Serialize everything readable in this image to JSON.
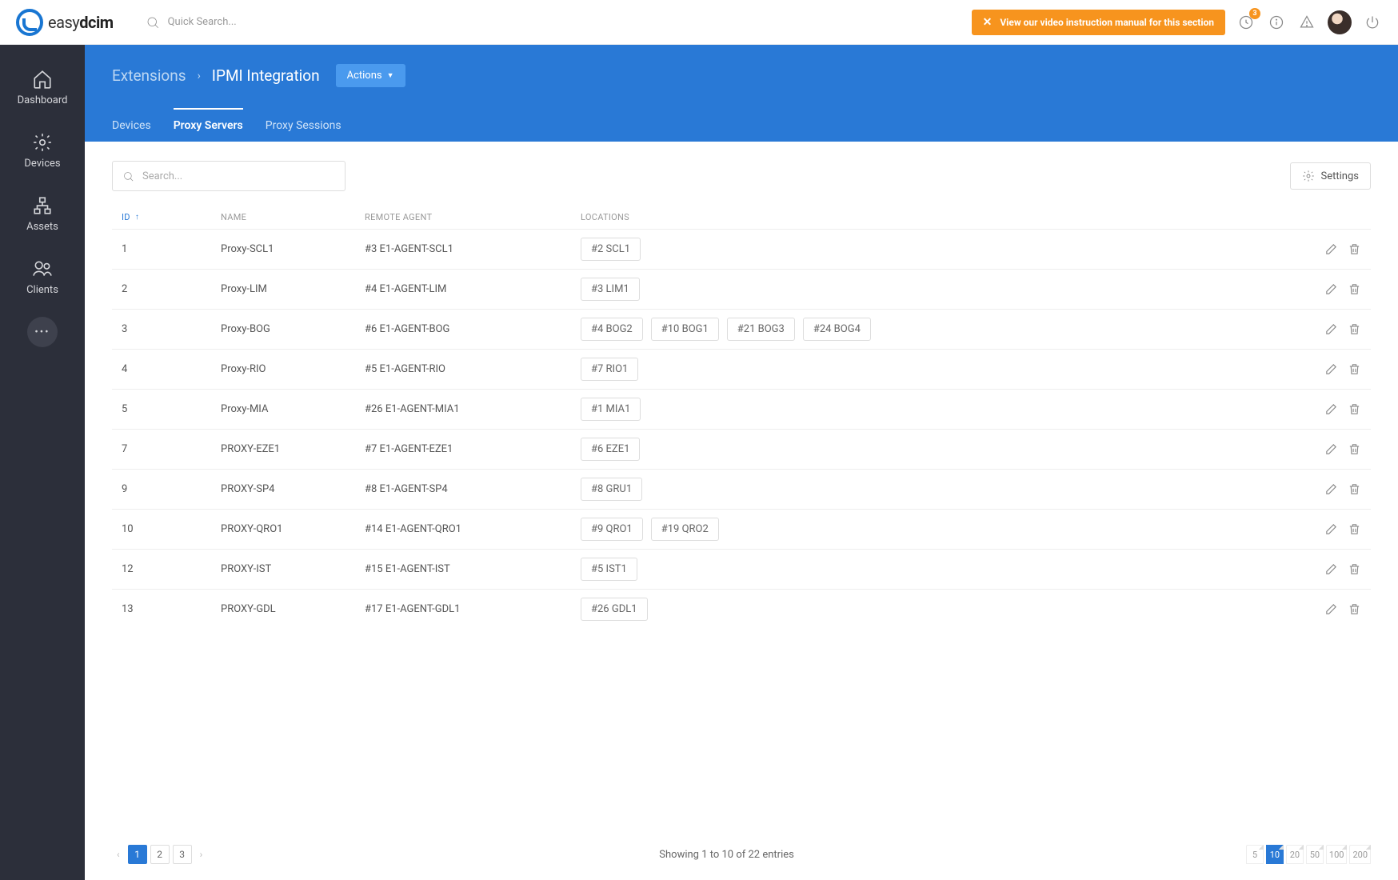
{
  "brand": {
    "easy": "easy",
    "dcim": "dcim"
  },
  "topbar": {
    "search_placeholder": "Quick Search...",
    "banner": "View our video instruction manual for this section",
    "badge_count": "3"
  },
  "sidebar": {
    "items": [
      {
        "label": "Dashboard"
      },
      {
        "label": "Devices"
      },
      {
        "label": "Assets"
      },
      {
        "label": "Clients"
      }
    ]
  },
  "header": {
    "crumb1": "Extensions",
    "crumb2": "IPMI Integration",
    "actions_label": "Actions",
    "tabs": [
      {
        "label": "Devices"
      },
      {
        "label": "Proxy Servers"
      },
      {
        "label": "Proxy Sessions"
      }
    ]
  },
  "toolbar": {
    "search_placeholder": "Search...",
    "settings_label": "Settings"
  },
  "columns": {
    "id": "ID",
    "name": "NAME",
    "agent": "REMOTE AGENT",
    "locations": "LOCATIONS"
  },
  "rows": [
    {
      "id": "1",
      "name": "Proxy-SCL1",
      "agent": "#3 E1-AGENT-SCL1",
      "locations": [
        "#2 SCL1"
      ]
    },
    {
      "id": "2",
      "name": "Proxy-LIM",
      "agent": "#4 E1-AGENT-LIM",
      "locations": [
        "#3 LIM1"
      ]
    },
    {
      "id": "3",
      "name": "Proxy-BOG",
      "agent": "#6 E1-AGENT-BOG",
      "locations": [
        "#4 BOG2",
        "#10 BOG1",
        "#21 BOG3",
        "#24 BOG4"
      ]
    },
    {
      "id": "4",
      "name": "Proxy-RIO",
      "agent": "#5 E1-AGENT-RIO",
      "locations": [
        "#7 RIO1"
      ]
    },
    {
      "id": "5",
      "name": "Proxy-MIA",
      "agent": "#26 E1-AGENT-MIA1",
      "locations": [
        "#1 MIA1"
      ]
    },
    {
      "id": "7",
      "name": "PROXY-EZE1",
      "agent": "#7 E1-AGENT-EZE1",
      "locations": [
        "#6 EZE1"
      ]
    },
    {
      "id": "9",
      "name": "PROXY-SP4",
      "agent": "#8 E1-AGENT-SP4",
      "locations": [
        "#8 GRU1"
      ]
    },
    {
      "id": "10",
      "name": "PROXY-QRO1",
      "agent": "#14 E1-AGENT-QRO1",
      "locations": [
        "#9 QRO1",
        "#19 QRO2"
      ]
    },
    {
      "id": "12",
      "name": "PROXY-IST",
      "agent": "#15 E1-AGENT-IST",
      "locations": [
        "#5 IST1"
      ]
    },
    {
      "id": "13",
      "name": "PROXY-GDL",
      "agent": "#17 E1-AGENT-GDL1",
      "locations": [
        "#26 GDL1"
      ]
    }
  ],
  "footer": {
    "pages": [
      "1",
      "2",
      "3"
    ],
    "active_page": "1",
    "summary": "Showing 1 to 10 of 22 entries",
    "page_sizes": [
      "5",
      "10",
      "20",
      "50",
      "100",
      "200"
    ],
    "active_size": "10"
  }
}
